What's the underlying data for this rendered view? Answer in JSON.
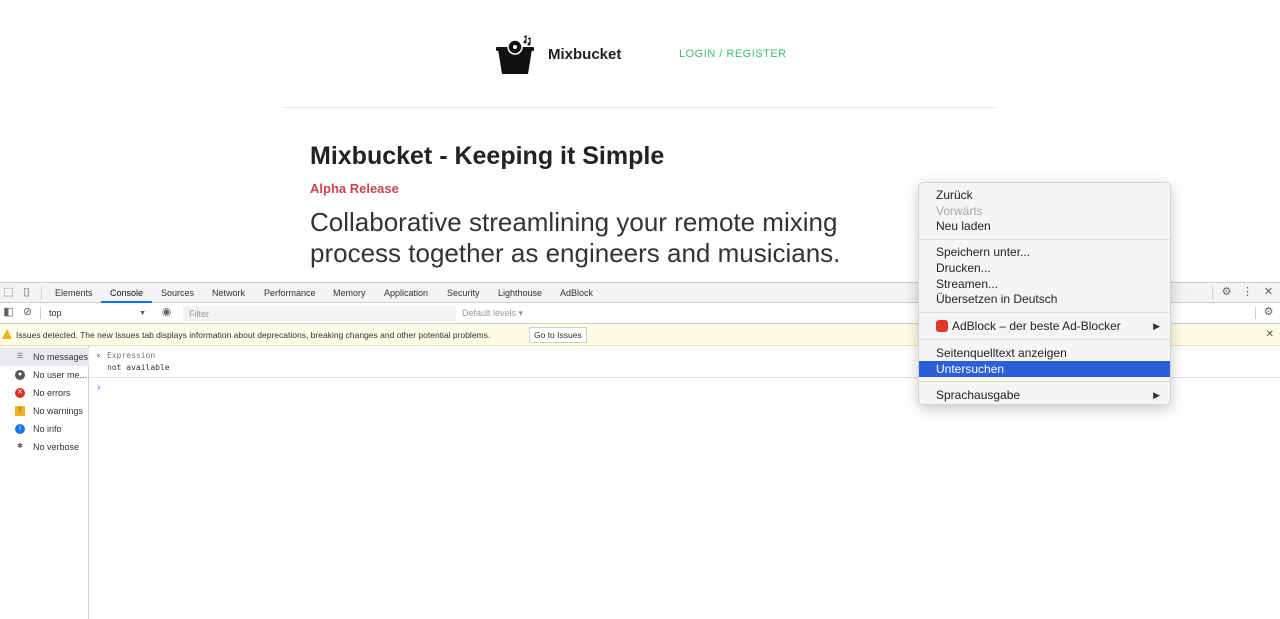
{
  "site": {
    "brand": "Mixbucket",
    "login": "LOGIN / REGISTER",
    "hero_title": "Mixbucket - Keeping it Simple",
    "badge": "Alpha Release",
    "tagline": "Collaborative streamlining your remote mixing process together as engineers and musicians."
  },
  "devtools": {
    "tabs": [
      "Elements",
      "Console",
      "Sources",
      "Network",
      "Performance",
      "Memory",
      "Application",
      "Security",
      "Lighthouse",
      "AdBlock"
    ],
    "active_tab": "Console",
    "context": "top",
    "filter_placeholder": "Filter",
    "levels": "Default levels ▾",
    "issues_text": "Issues detected. The new Issues tab displays information about deprecations, breaking changes and other potential problems.",
    "issues_button": "Go to Issues",
    "sidebar": [
      {
        "label": "No messages",
        "icon": "list-icon"
      },
      {
        "label": "No user me...",
        "icon": "user-icon"
      },
      {
        "label": "No errors",
        "icon": "error-icon"
      },
      {
        "label": "No warnings",
        "icon": "warning-icon"
      },
      {
        "label": "No info",
        "icon": "info-icon"
      },
      {
        "label": "No verbose",
        "icon": "bug-icon"
      }
    ],
    "expression_label": "Expression",
    "expression_value": "not available",
    "prompt": "›"
  },
  "context_menu": {
    "items": [
      {
        "label": "Zurück",
        "disabled": false
      },
      {
        "label": "Vorwärts",
        "disabled": true
      },
      {
        "label": "Neu laden",
        "disabled": false
      },
      {
        "label": "Speichern unter...",
        "disabled": false
      },
      {
        "label": "Drucken...",
        "disabled": false
      },
      {
        "label": "Streamen...",
        "disabled": false
      },
      {
        "label": "Übersetzen in Deutsch",
        "disabled": false
      },
      {
        "label": "AdBlock – der beste Ad-Blocker",
        "submenu": true
      },
      {
        "label": "Seitenquelltext anzeigen",
        "disabled": false
      },
      {
        "label": "Untersuchen",
        "highlighted": true
      },
      {
        "label": "Sprachausgabe",
        "submenu": true
      }
    ]
  },
  "colors": {
    "login": "#3fbf6f",
    "badge": "#c9444e",
    "menu_highlight": "#2a5fd8",
    "active_tab": "#1a73e8"
  }
}
